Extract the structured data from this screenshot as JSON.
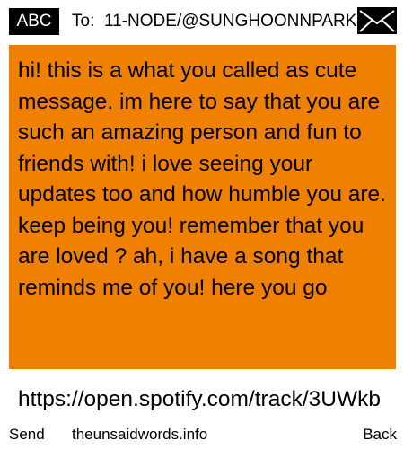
{
  "header": {
    "mode_badge": "ABC",
    "to_label": "To:",
    "recipient": "11-NODE/@SUNGHOONNPARK",
    "envelope_icon": "envelope-icon"
  },
  "message": {
    "body": "hi! this is a what you called as cute message. im here to say that you are such an amazing person and fun to friends with! i love seeing your updates too and how humble you are. keep being you! remember that you are loved ? ah, i have a song that reminds me of you! here you go",
    "background_color": "#f08000"
  },
  "link": {
    "text": "https://open.spotify.com/track/3UWkb"
  },
  "footer": {
    "left_softkey": "Send",
    "center_text": "theunsaidwords.info",
    "right_softkey": "Back"
  }
}
